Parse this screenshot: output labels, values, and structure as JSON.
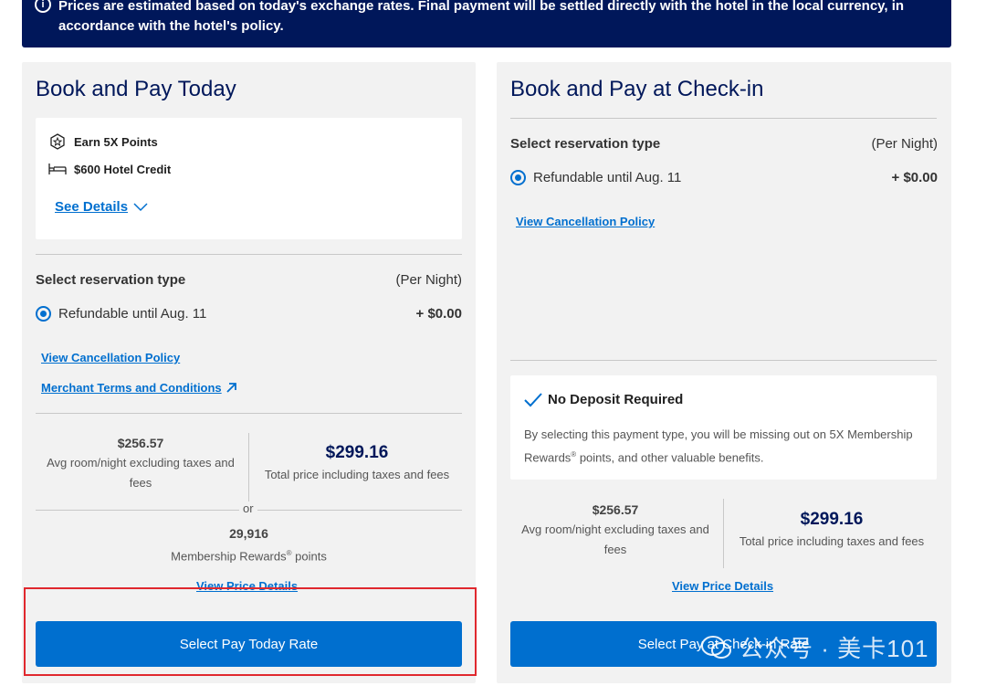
{
  "banner": {
    "text": "Prices are estimated based on today's exchange rates. Final payment will be settled directly with the hotel in the local currency, in accordance with the hotel's policy."
  },
  "left_card": {
    "title": "Book and Pay Today",
    "benefits": [
      {
        "icon": "star-badge-icon",
        "label": "Earn 5X Points"
      },
      {
        "icon": "bed-icon",
        "label": "$600 Hotel Credit"
      }
    ],
    "see_details": "See Details",
    "reservation_label": "Select reservation type",
    "per_night": "(Per Night)",
    "option_label": "Refundable until Aug. 11",
    "option_price": "+ $0.00",
    "cancellation_link": "View Cancellation Policy",
    "merchant_link": "Merchant Terms and Conditions",
    "avg_price": "$256.57",
    "avg_caption": "Avg room/night excluding taxes and fees",
    "total_price": "$299.16",
    "total_caption": "Total price including taxes and fees",
    "or": "or",
    "points": "29,916",
    "points_caption_pre": "Membership Rewards",
    "points_caption_post": " points",
    "price_details_link": "View Price Details",
    "button": "Select Pay Today Rate"
  },
  "right_card": {
    "title": "Book and Pay at Check-in",
    "reservation_label": "Select reservation type",
    "per_night": "(Per Night)",
    "option_label": "Refundable until Aug. 11",
    "option_price": "+ $0.00",
    "cancellation_link": "View Cancellation Policy",
    "no_deposit_title": "No Deposit Required",
    "no_deposit_desc_pre": "By selecting this payment type, you will be missing out on 5X Membership Rewards",
    "no_deposit_desc_post": " points, and other valuable benefits.",
    "avg_price": "$256.57",
    "avg_caption": "Avg room/night excluding taxes and fees",
    "total_price": "$299.16",
    "total_caption": "Total price including taxes and fees",
    "price_details_link": "View Price Details",
    "button": "Select Pay at Check-in Rate"
  },
  "registered_mark": "®",
  "watermark": "公众号 · 美卡101",
  "colors": {
    "brand_navy": "#00175a",
    "brand_blue": "#006fcf",
    "highlight_red": "#e0282e"
  }
}
